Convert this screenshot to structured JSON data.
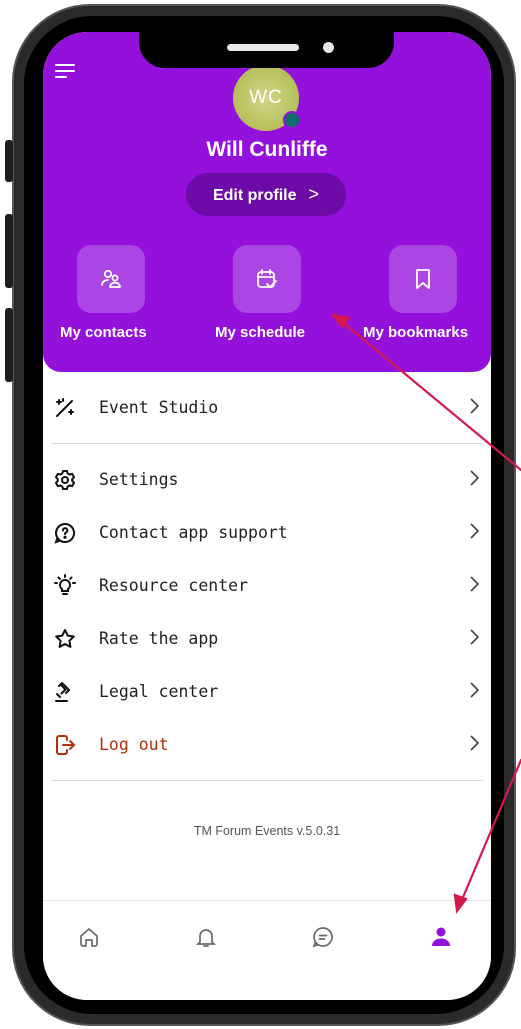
{
  "profile": {
    "initials": "WC",
    "name": "Will Cunliffe",
    "edit_label": "Edit profile",
    "edit_chevron": ">"
  },
  "quick_actions": [
    {
      "label": "My contacts",
      "icon": "contacts-icon"
    },
    {
      "label": "My schedule",
      "icon": "calendar-check-icon"
    },
    {
      "label": "My bookmarks",
      "icon": "bookmark-icon"
    }
  ],
  "menu": [
    {
      "label": "Event Studio",
      "icon": "magic-wand-icon"
    },
    {
      "label": "Settings",
      "icon": "gear-icon"
    },
    {
      "label": "Contact app support",
      "icon": "help-circle-icon"
    },
    {
      "label": "Resource center",
      "icon": "lightbulb-icon"
    },
    {
      "label": "Rate the app",
      "icon": "star-icon"
    },
    {
      "label": "Legal center",
      "icon": "gavel-icon"
    },
    {
      "label": "Log out",
      "icon": "logout-icon"
    }
  ],
  "version": "TM Forum Events v.5.0.31",
  "bottom_nav": [
    {
      "name": "home",
      "icon": "home-icon",
      "active": false
    },
    {
      "name": "notifications",
      "icon": "bell-icon",
      "active": false
    },
    {
      "name": "messages",
      "icon": "chat-icon",
      "active": false
    },
    {
      "name": "profile",
      "icon": "user-icon",
      "active": true
    }
  ],
  "colors": {
    "brand_purple": "#9411dc",
    "button_purple": "#6e0ba8",
    "logout_red": "#b0300c",
    "annotation_arrow": "#d6184a",
    "nav_inactive": "#6b6b6b"
  }
}
